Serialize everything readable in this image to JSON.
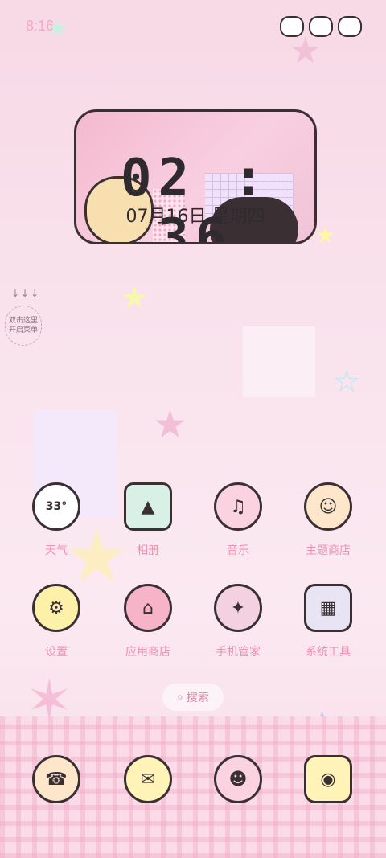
{
  "status_bar": {
    "time": "8:16"
  },
  "clock_widget": {
    "time": "02 : 36",
    "date": "07月16日  星期四"
  },
  "hint": {
    "arrows": "↓↓↓",
    "text": "双击这里开启菜单"
  },
  "apps": [
    {
      "label": "天气",
      "icon": "weather-icon",
      "badge": "33°",
      "color": "#ffffff"
    },
    {
      "label": "相册",
      "icon": "gallery-icon",
      "color": "#d8f0e6"
    },
    {
      "label": "音乐",
      "icon": "music-icon",
      "color": "#fbd2df"
    },
    {
      "label": "主题商店",
      "icon": "theme-store-icon",
      "color": "#fde6c9"
    },
    {
      "label": "设置",
      "icon": "settings-icon",
      "color": "#fdf0a8"
    },
    {
      "label": "应用商店",
      "icon": "app-store-icon",
      "color": "#f7b3c8"
    },
    {
      "label": "手机管家",
      "icon": "phone-manager-icon",
      "color": "#f4d1e0"
    },
    {
      "label": "系统工具",
      "icon": "system-tools-icon",
      "color": "#e9e4f4"
    }
  ],
  "search": {
    "label": "搜索"
  },
  "dock": [
    {
      "icon": "phone-icon",
      "color": "#fde6c9"
    },
    {
      "icon": "messages-icon",
      "color": "#fff3b8"
    },
    {
      "icon": "contacts-icon",
      "color": "#fbd2df"
    },
    {
      "icon": "camera-icon",
      "color": "#fff3b8"
    }
  ]
}
